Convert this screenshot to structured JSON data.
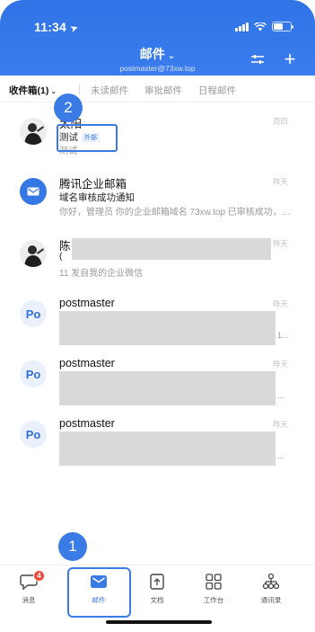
{
  "status_bar": {
    "time": "11:34",
    "location_arrow": "➤"
  },
  "header": {
    "title": "邮件",
    "title_caret": "⌄",
    "account": "postmaster@73xw.top",
    "plus_label": "+"
  },
  "tabs": [
    {
      "label": "收件箱(1)",
      "caret": "⌄"
    },
    {
      "label": "未读邮件"
    },
    {
      "label": "审批邮件"
    },
    {
      "label": "日程邮件"
    }
  ],
  "mails": [
    {
      "sender": "太阳",
      "date": "周四",
      "subject": "测试",
      "ext_tag": "外部",
      "preview": "测试"
    },
    {
      "sender": "腾讯企业邮箱",
      "date": "昨天",
      "subject": "域名审核成功通知",
      "preview": "你好，管理员 你的企业邮箱域名 73xw.top 已审核成功，现..."
    },
    {
      "sender": "陈",
      "date": "昨天",
      "subject": "(",
      "preview": "11  发自我的企业微信"
    },
    {
      "sender": "postmaster",
      "date": "昨天",
      "avatar": "Po",
      "ellipsis": "1..."
    },
    {
      "sender": "postmaster",
      "date": "昨天",
      "avatar": "Po",
      "ellipsis": "..."
    },
    {
      "sender": "postmaster",
      "date": "昨天",
      "avatar": "Po",
      "ellipsis": "..."
    }
  ],
  "annotations": {
    "step1": "1",
    "step2": "2"
  },
  "bottom_nav": [
    {
      "label": "消息",
      "icon": "chat-bubble-icon",
      "badge": "4"
    },
    {
      "label": "邮件",
      "icon": "mail-icon"
    },
    {
      "label": "文档",
      "icon": "document-icon"
    },
    {
      "label": "工作台",
      "icon": "grid-icon"
    },
    {
      "label": "通讯录",
      "icon": "contacts-icon"
    }
  ],
  "colors": {
    "brand": "#3a7be6",
    "header": "#3b7dee",
    "badge": "#f04a3a"
  }
}
